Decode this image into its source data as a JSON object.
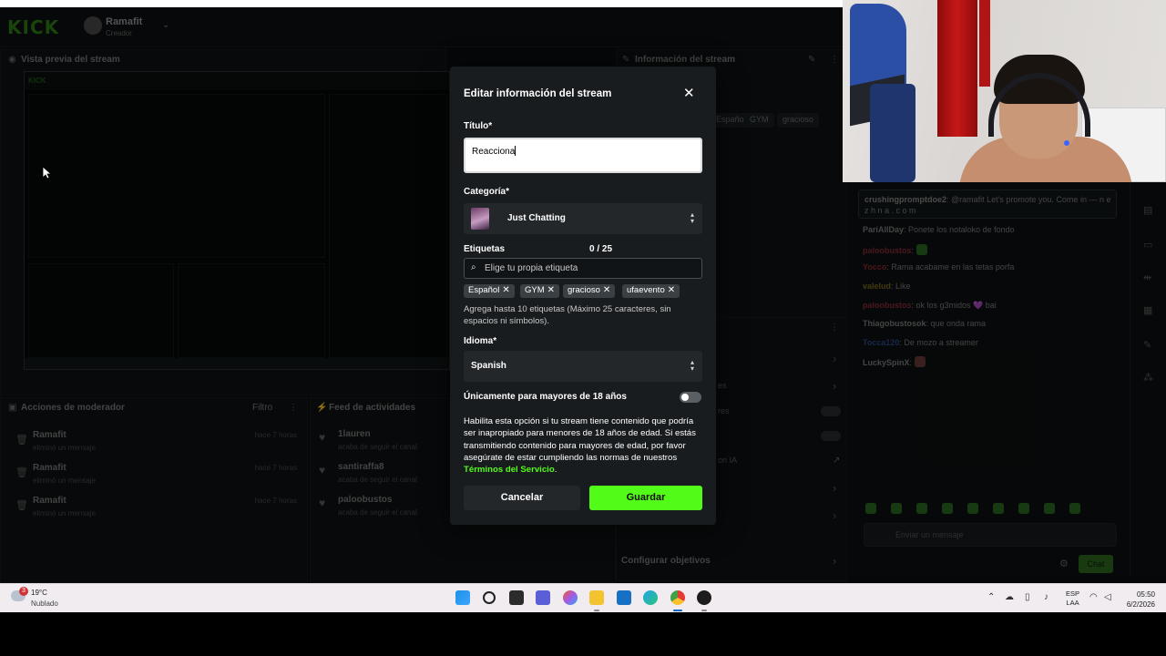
{
  "dashboard": {
    "logo": "KICK",
    "user": {
      "name": "Ramafit",
      "role": "Creador"
    },
    "preview_title": "Vista previa del stream",
    "info_title": "Información del stream",
    "info_tags": [
      "Español",
      "GYM",
      "gracioso"
    ],
    "mod_panel": {
      "title": "Acciones de moderador",
      "filter_label": "Filtro",
      "rows": [
        {
          "name": "Ramafit",
          "action": "eliminó un mensaje",
          "ago": "hace 7 horas"
        },
        {
          "name": "Ramafit",
          "action": "eliminó un mensaje",
          "ago": "hace 7 horas"
        },
        {
          "name": "Ramafit",
          "action": "eliminó un mensaje",
          "ago": "hace 7 horas"
        }
      ]
    },
    "feed_panel": {
      "title": "Feed de actividades",
      "rows": [
        {
          "name": "1lauren",
          "action": "acaba de seguir el canal"
        },
        {
          "name": "santiraffa8",
          "action": "acaba de seguir el canal"
        },
        {
          "name": "paloobustos",
          "action": "acaba de seguir el canal"
        }
      ]
    },
    "right_items": [
      "es",
      "res",
      "on IA",
      "Configurar objetivos"
    ]
  },
  "chat": {
    "highlight": {
      "user": "crushingpromptdoe2",
      "text": "@ramafit Let's promote you. Come in — n e z h n a . c o m"
    },
    "messages": [
      {
        "user": "PariAllDay",
        "text": "Ponete los notaloko de fondo",
        "color": "#7f7f7f"
      },
      {
        "user": "paloobustos",
        "text": "",
        "color": "#8a2a3a"
      },
      {
        "user": "Yocco",
        "text": "Rama acabame en las tetas porfa",
        "color": "#8a2a2a"
      },
      {
        "user": "valelud",
        "text": "Like",
        "color": "#7a6a1a"
      },
      {
        "user": "paloobustos",
        "text": "ok los g3midos 💜 bai",
        "color": "#8a2a3a"
      },
      {
        "user": "Thiagobustosok",
        "text": "que onda rama",
        "color": "#7f7f7f"
      },
      {
        "user": "Tocca120",
        "text": "De mozo a streamer",
        "color": "#2a4a8a"
      },
      {
        "user": "LuckySpinX",
        "text": "",
        "color": "#7f7f7f"
      }
    ],
    "input_placeholder": "Enviar un mensaje",
    "send_label": "Chat"
  },
  "modal": {
    "title": "Editar información del stream",
    "title_label": "Título*",
    "title_value": "Reacciona",
    "category_label": "Categoría*",
    "category_value": "Just Chatting",
    "tags_label": "Etiquetas",
    "tags_counter": "0 / 25",
    "tags_placeholder": "Elige tu propia etiqueta",
    "tags": [
      "Español",
      "GYM",
      "gracioso",
      "ufaevento"
    ],
    "tags_help": "Agrega hasta 10 etiquetas (Máximo 25 caracteres, sin espacios ni símbolos).",
    "language_label": "Idioma*",
    "language_value": "Spanish",
    "adult_label": "Únicamente para mayores de 18 años",
    "adult_desc": "Habilita esta opción si tu stream tiene contenido que podría ser inapropiado para menores de 18 años de edad. Si estás transmitiendo contenido para mayores de edad, por favor asegúrate de estar cumpliendo las normas de nuestros ",
    "adult_link": "Términos del Servicio",
    "adult_desc_end": ".",
    "cancel_label": "Cancelar",
    "save_label": "Guardar",
    "accent_color": "#53fc18"
  },
  "taskbar": {
    "weather_temp": "19°C",
    "weather_desc": "Nublado",
    "weather_badge": "3",
    "lang_top": "ESP",
    "lang_bottom": "LAA",
    "time": "05:50",
    "date": "6/2/2026"
  }
}
